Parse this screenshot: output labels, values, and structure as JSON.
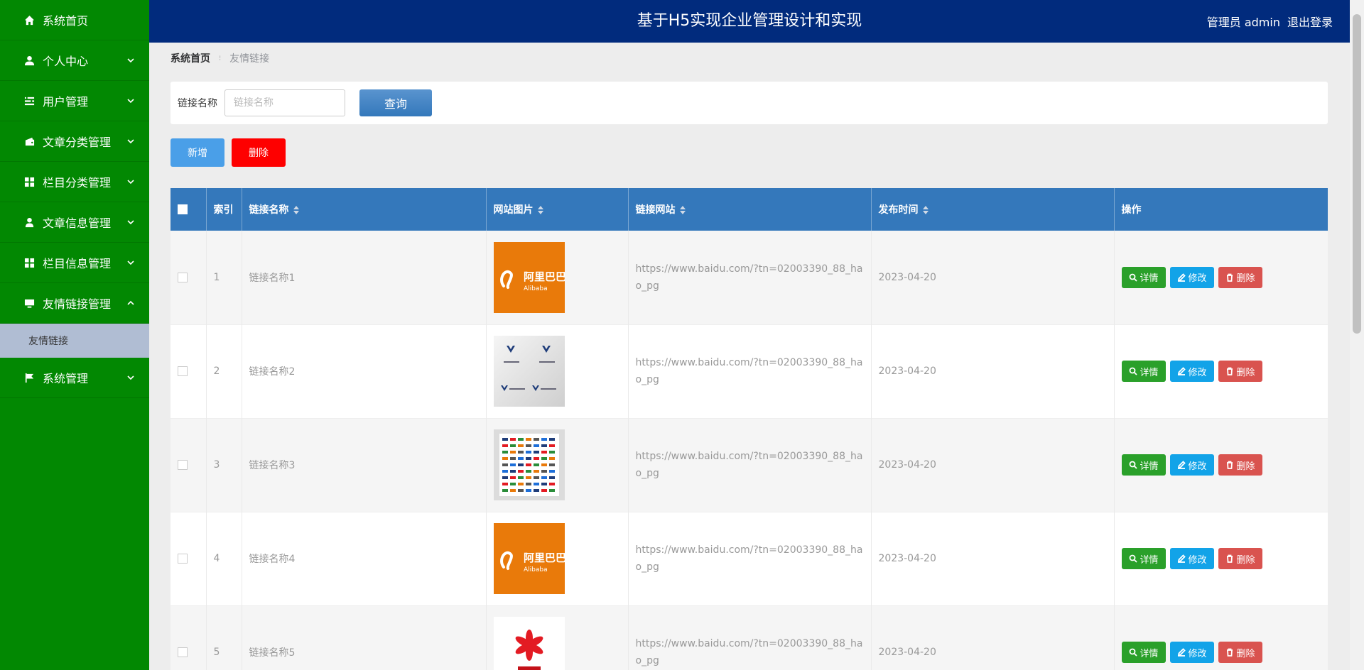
{
  "header": {
    "title": "基于H5实现企业管理设计和实现",
    "user": "管理员 admin",
    "logout": "退出登录"
  },
  "sidebar": {
    "items": [
      {
        "label": "系统首页",
        "icon": "home-icon",
        "chevron": false
      },
      {
        "label": "个人中心",
        "icon": "user-icon",
        "chevron": "down"
      },
      {
        "label": "用户管理",
        "icon": "list-icon",
        "chevron": "down"
      },
      {
        "label": "文章分类管理",
        "icon": "wallet-icon",
        "chevron": "down"
      },
      {
        "label": "栏目分类管理",
        "icon": "grid-icon",
        "chevron": "down"
      },
      {
        "label": "文章信息管理",
        "icon": "person-icon",
        "chevron": "down"
      },
      {
        "label": "栏目信息管理",
        "icon": "grid-icon",
        "chevron": "down"
      },
      {
        "label": "友情链接管理",
        "icon": "monitor-icon",
        "chevron": "up"
      },
      {
        "label": "系统管理",
        "icon": "flag-icon",
        "chevron": "down"
      }
    ],
    "sub_item": "友情链接"
  },
  "breadcrumb": {
    "home": "系统首页",
    "current": "友情链接"
  },
  "search": {
    "label": "链接名称",
    "placeholder": "链接名称",
    "button": "查询"
  },
  "actions": {
    "add": "新增",
    "delete": "删除"
  },
  "table": {
    "columns": [
      "索引",
      "链接名称",
      "网站图片",
      "链接网站",
      "发布时间",
      "操作"
    ],
    "rows": [
      {
        "index": "1",
        "name": "链接名称1",
        "image": "alibaba-logo",
        "url": "https://www.baidu.com/?tn=02003390_88_hao_pg",
        "date": "2023-04-20"
      },
      {
        "index": "2",
        "name": "链接名称2",
        "image": "wp-logo",
        "url": "https://www.baidu.com/?tn=02003390_88_hao_pg",
        "date": "2023-04-20"
      },
      {
        "index": "3",
        "name": "链接名称3",
        "image": "logos-collage",
        "url": "https://www.baidu.com/?tn=02003390_88_hao_pg",
        "date": "2023-04-20"
      },
      {
        "index": "4",
        "name": "链接名称4",
        "image": "alibaba-logo",
        "url": "https://www.baidu.com/?tn=02003390_88_hao_pg",
        "date": "2023-04-20"
      },
      {
        "index": "5",
        "name": "链接名称5",
        "image": "yanchang-logo",
        "url": "https://www.baidu.com/?tn=02003390_88_hao_pg",
        "date": "2023-04-20"
      }
    ],
    "ops": {
      "detail": "详情",
      "edit": "修改",
      "delete": "删除"
    }
  },
  "logo_text": {
    "alibaba_cn": "阿里巴巴",
    "alibaba_en": "Alibaba"
  },
  "colors": {
    "sidebar": "#028802",
    "header": "#012b7d",
    "table_header": "#3478bb",
    "sub_item": "#b0bdd3",
    "add": "#4a9fe8",
    "delete": "#fe0000"
  }
}
